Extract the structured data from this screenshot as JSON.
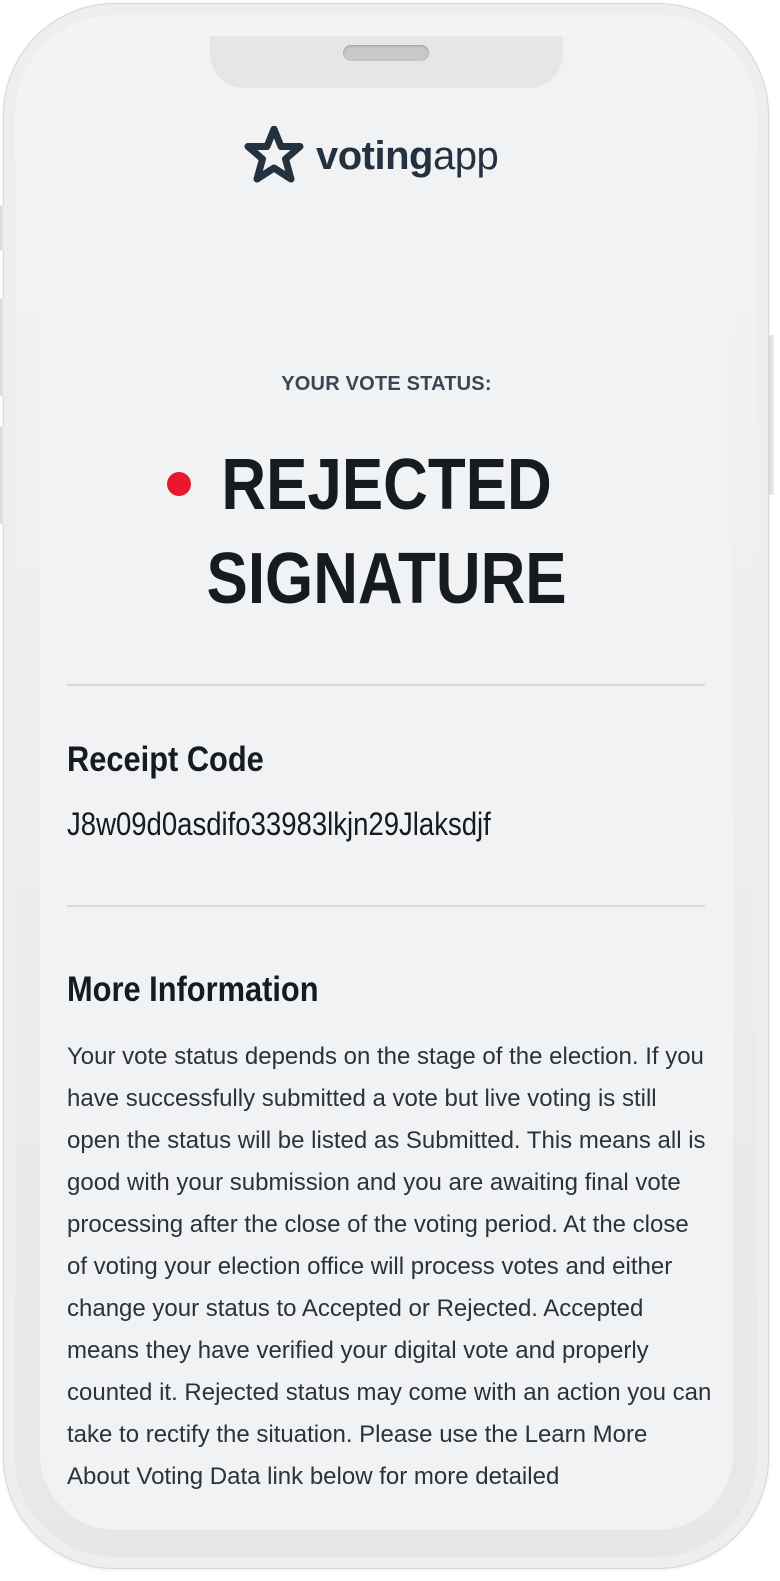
{
  "app": {
    "brand_bold": "voting",
    "brand_regular": "app",
    "logo_icon": "star-outline-icon"
  },
  "status": {
    "label": "YOUR VOTE STATUS:",
    "value_line1": "REJECTED",
    "value_line2": "SIGNATURE",
    "indicator_color": "#e8192c"
  },
  "receipt": {
    "heading": "Receipt Code",
    "code": "J8w09d0asdifo33983lkjn29Jlaksdjf"
  },
  "more_info": {
    "heading": "More Information",
    "body": "Your vote status depends on the stage of the election. If you have successfully submitted a vote but live voting is still open the status will be listed as Submitted. This means all is good with your submission and you are awaiting final vote processing after the close of the voting period. At the close of voting your election office will process votes and either change your status to Accepted or Rejected. Accepted means they have verified your digital vote and properly counted it. Rejected status may come with an action you can take to rectify the situation. Please use the Learn More About Voting Data link below for more detailed"
  },
  "colors": {
    "background": "#f1f2f4",
    "text_dark": "#161b21",
    "brand": "#243240",
    "status_rejected": "#e8192c"
  }
}
